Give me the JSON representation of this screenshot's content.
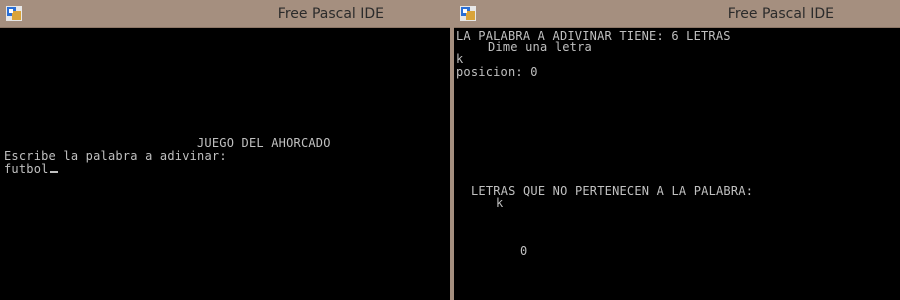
{
  "left_window": {
    "title": "Free Pascal IDE",
    "icon": "free-pascal-ide-icon",
    "console": {
      "heading": "JUEGO DEL AHORCADO",
      "prompt": "Escribe la palabra a adivinar:",
      "input_value": "futbol"
    }
  },
  "right_window": {
    "title": "Free Pascal IDE",
    "icon": "free-pascal-ide-icon",
    "console": {
      "word_length_line": "LA PALABRA A ADIVINAR TIENE: 6 LETRAS",
      "ask_letter": "Dime una letra",
      "entered_letter": "k",
      "position_line": "posicion: 0",
      "wrong_letters_label": "LETRAS QUE NO PERTENECEN A LA PALABRA:",
      "wrong_letters": "k",
      "counter": "0"
    }
  },
  "colors": {
    "titlebar": "#a58f7f",
    "console_bg": "#000000",
    "console_text": "#c0c0c0"
  }
}
